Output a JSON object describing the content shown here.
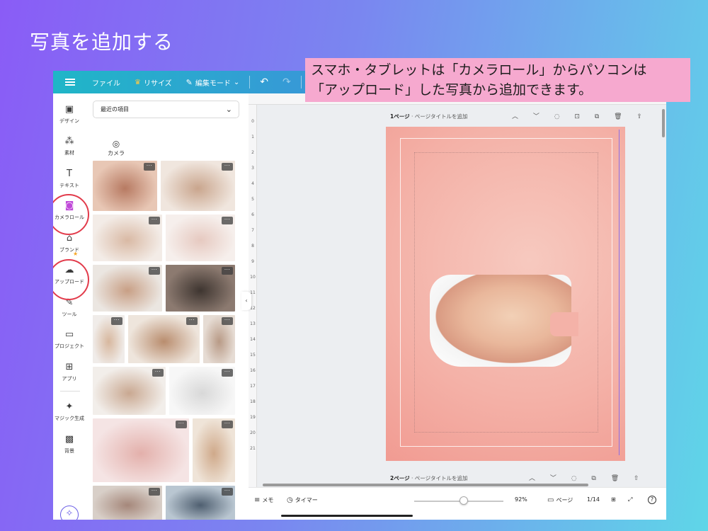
{
  "slide": {
    "title": "写真を追加する",
    "callout_line1": "スマホ・タブレットは「カメラロール」からパソコンは",
    "callout_line2": "「アップロード」した写真から追加できます。"
  },
  "topbar": {
    "file": "ファイル",
    "resize": "リサイズ",
    "edit_mode": "編集モード",
    "chevron": "⌄",
    "undo": "↶",
    "redo": "↷"
  },
  "rail": {
    "items": [
      {
        "label": "デザイン",
        "icon": "▣"
      },
      {
        "label": "素材",
        "icon": "⁂"
      },
      {
        "label": "テキスト",
        "icon": "T"
      },
      {
        "label": "カメラロール",
        "icon": "◙"
      },
      {
        "label": "ブランド",
        "icon": "⌂"
      },
      {
        "label": "アップロード",
        "icon": "☁"
      },
      {
        "label": "ツール",
        "icon": "✎"
      },
      {
        "label": "プロジェクト",
        "icon": "▭"
      },
      {
        "label": "アプリ",
        "icon": "⊞"
      },
      {
        "label": "マジック生成",
        "icon": "✦"
      },
      {
        "label": "背景",
        "icon": "▩"
      }
    ],
    "magic_icon": "✧"
  },
  "panel": {
    "dropdown_value": "最近の項目",
    "dropdown_chevron": "⌄",
    "camera_label": "カメラ",
    "camera_icon": "◎",
    "more_glyph": "···",
    "collapse_glyph": "‹"
  },
  "canvas": {
    "page1_label": "1ページ",
    "page1_title": "ページタイトルを追加",
    "page2_label": "2ページ",
    "page2_title": "ページタイトルを追加",
    "page1_tools": "︿ ﹀ ◌ ⊡ ⧉ 🗑 ⇧",
    "page2_tools": "︿ ﹀ ◌ ⧉ 🗑 ⇧",
    "ruler_numbers": [
      "0",
      "1",
      "2",
      "3",
      "4",
      "5",
      "6",
      "7",
      "8",
      "9",
      "10",
      "11",
      "12",
      "13",
      "14",
      "15",
      "16",
      "17",
      "18",
      "19",
      "20",
      "21"
    ]
  },
  "bottombar": {
    "notes_icon": "≡",
    "notes": "メモ",
    "timer_icon": "◷",
    "timer": "タイマー",
    "zoom": "92%",
    "page_icon": "▭",
    "pages": "ページ",
    "page_count": "1/14",
    "grid_icon": "⊞",
    "fullscreen_icon": "⤢",
    "help_icon": "?"
  },
  "photos": [
    {
      "tone": [
        "#e8c7b5",
        "#b77a62"
      ]
    },
    {
      "tone": [
        "#f0e6de",
        "#c9a58d"
      ]
    },
    {
      "tone": [
        "#f3ece7",
        "#d9b9a4"
      ]
    },
    {
      "tone": [
        "#f6efec",
        "#e6c9c0"
      ]
    },
    {
      "tone": [
        "#ebe6e1",
        "#c89f85"
      ]
    },
    {
      "tone": [
        "#8c7a70",
        "#3e3530"
      ]
    },
    {
      "tone": [
        "#f0ece9",
        "#d7b79e"
      ]
    },
    {
      "tone": [
        "#eee5dc",
        "#b98d6e"
      ]
    },
    {
      "tone": [
        "#e6dcd4",
        "#b89a86"
      ]
    },
    {
      "tone": [
        "#f2eeea",
        "#c9a891"
      ]
    },
    {
      "tone": [
        "#f7f7f7",
        "#d8d8d8"
      ]
    },
    {
      "tone": [
        "#f5e4e4",
        "#e3b0ab"
      ]
    },
    {
      "tone": [
        "#efe4d8",
        "#cfa98a"
      ]
    },
    {
      "tone": [
        "#d8cfc8",
        "#a5877a"
      ]
    },
    {
      "tone": [
        "#b9c6d1",
        "#4f5f70"
      ]
    }
  ]
}
